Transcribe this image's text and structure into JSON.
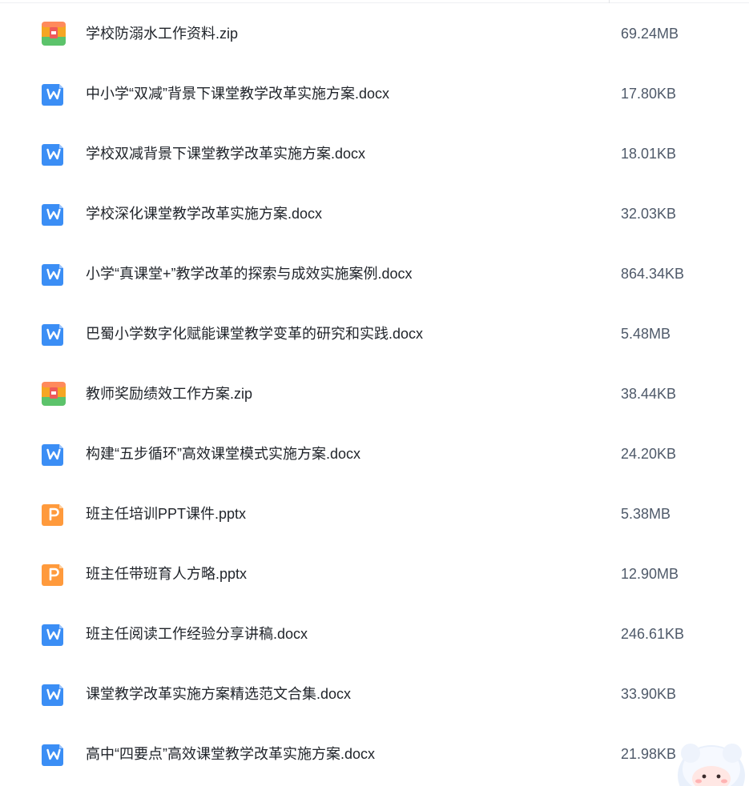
{
  "files": [
    {
      "type": "zip",
      "icon": "archive-icon",
      "name": "学校防溺水工作资料.zip",
      "size": "69.24MB"
    },
    {
      "type": "docx",
      "icon": "word-doc-icon",
      "name": "中小学“双减”背景下课堂教学改革实施方案.docx",
      "size": "17.80KB"
    },
    {
      "type": "docx",
      "icon": "word-doc-icon",
      "name": "学校双减背景下课堂教学改革实施方案.docx",
      "size": "18.01KB"
    },
    {
      "type": "docx",
      "icon": "word-doc-icon",
      "name": "学校深化课堂教学改革实施方案.docx",
      "size": "32.03KB"
    },
    {
      "type": "docx",
      "icon": "word-doc-icon",
      "name": "小学“真课堂+”教学改革的探索与成效实施案例.docx",
      "size": "864.34KB"
    },
    {
      "type": "docx",
      "icon": "word-doc-icon",
      "name": "巴蜀小学数字化赋能课堂教学变革的研究和实践.docx",
      "size": "5.48MB"
    },
    {
      "type": "zip",
      "icon": "archive-icon",
      "name": "教师奖励绩效工作方案.zip",
      "size": "38.44KB"
    },
    {
      "type": "docx",
      "icon": "word-doc-icon",
      "name": "构建“五步循环”高效课堂模式实施方案.docx",
      "size": "24.20KB"
    },
    {
      "type": "pptx",
      "icon": "ppt-icon",
      "name": "班主任培训PPT课件.pptx",
      "size": "5.38MB"
    },
    {
      "type": "pptx",
      "icon": "ppt-icon",
      "name": "班主任带班育人方略.pptx",
      "size": "12.90MB"
    },
    {
      "type": "docx",
      "icon": "word-doc-icon",
      "name": "班主任阅读工作经验分享讲稿.docx",
      "size": "246.61KB"
    },
    {
      "type": "docx",
      "icon": "word-doc-icon",
      "name": "课堂教学改革实施方案精选范文合集.docx",
      "size": "33.90KB"
    },
    {
      "type": "docx",
      "icon": "word-doc-icon",
      "name": "高中“四要点”高效课堂教学改革实施方案.docx",
      "size": "21.98KB"
    }
  ],
  "colors": {
    "word": "#3b8ef5",
    "ppt": "#ff9a3c",
    "zip_orange": "#f5a623",
    "zip_green": "#5cc36b",
    "zip_red": "#ee5a5a"
  },
  "assistant_icon": "mascot-avatar-icon"
}
